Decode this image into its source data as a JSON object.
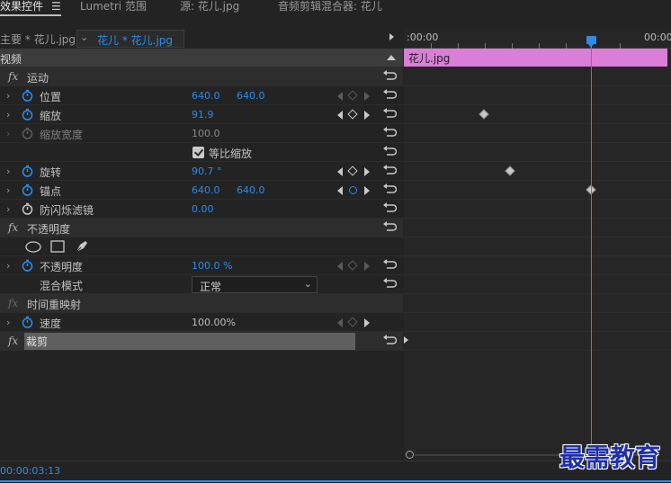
{
  "tabs": [
    {
      "label": "效果控件"
    },
    {
      "label": "Lumetri 范围"
    },
    {
      "label": "源: 花儿.jpg"
    },
    {
      "label": "音频剪辑混合器: 花儿"
    }
  ],
  "source_bar": {
    "master": "主要 * 花儿.jpg",
    "clip": "花儿 * 花儿.jpg"
  },
  "section_header": "视频",
  "motion": {
    "label": "运动",
    "position": {
      "label": "位置",
      "x": "640.0",
      "y": "640.0"
    },
    "scale": {
      "label": "缩放",
      "value": "91.9"
    },
    "scale_width": {
      "label": "缩放宽度",
      "value": "100.0"
    },
    "uniform_scale": {
      "label": "等比缩放"
    },
    "rotation": {
      "label": "旋转",
      "value": "90.7 °"
    },
    "anchor": {
      "label": "锚点",
      "x": "640.0",
      "y": "640.0"
    },
    "anti_flicker": {
      "label": "防闪烁滤镜",
      "value": "0.00"
    }
  },
  "opacity": {
    "label": "不透明度",
    "property": {
      "label": "不透明度",
      "value": "100.0 %"
    },
    "blend_mode": {
      "label": "混合模式",
      "value": "正常"
    }
  },
  "time_remap": {
    "label": "时间重映射",
    "speed": {
      "label": "速度",
      "value": "100.00%"
    }
  },
  "crop": {
    "label": "裁剪"
  },
  "timeline": {
    "start_time": ":00:00",
    "end_time": "00:00",
    "clip_name": "花儿.jpg",
    "playhead_fraction": 0.7
  },
  "footer": {
    "timecode": "00:00:03:13"
  },
  "watermark": "最需教育",
  "colors": {
    "accent": "#2d8ceb",
    "clip": "#da7ed8"
  }
}
